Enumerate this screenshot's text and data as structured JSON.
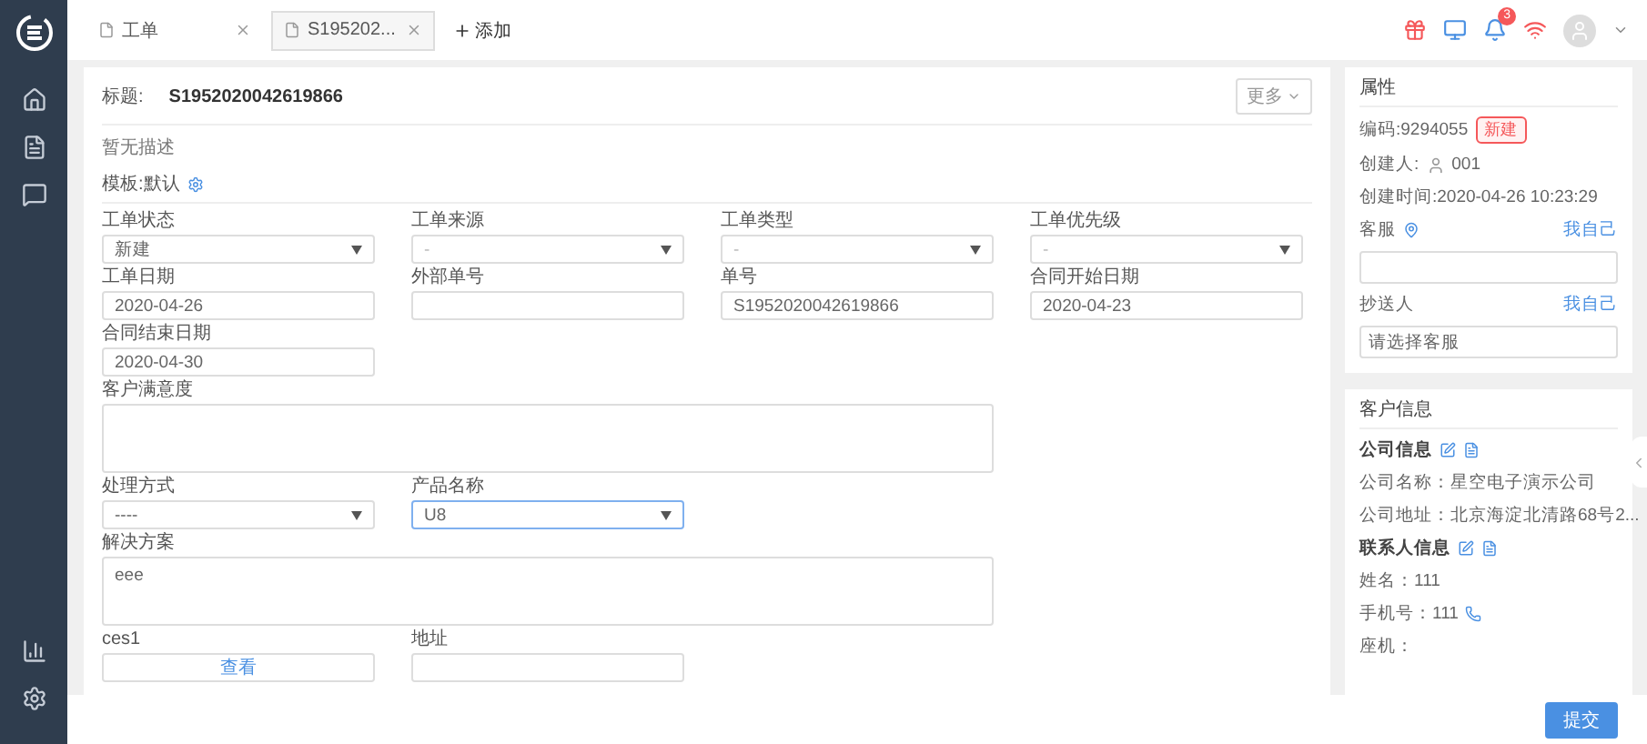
{
  "tabs": [
    {
      "label": "工单",
      "selected": false
    },
    {
      "label": "S195202...",
      "selected": true
    }
  ],
  "add_tab": "添加",
  "notifications": {
    "count": "3"
  },
  "main": {
    "title_label": "标题:",
    "title": "S1952020042619866",
    "more_button": "更多",
    "description": "暂无描述",
    "template": "模板:默认",
    "rows": [
      [
        {
          "kind": "select",
          "label": "工单状态",
          "value": "新建",
          "focused": false
        },
        {
          "kind": "select",
          "label": "工单来源",
          "placeholder": "-",
          "focused": false
        },
        {
          "kind": "select",
          "label": "工单类型",
          "placeholder": "-",
          "focused": false
        },
        {
          "kind": "select",
          "label": "工单优先级",
          "placeholder": "-",
          "focused": false
        }
      ],
      [
        {
          "kind": "input",
          "label": "工单日期",
          "value": "2020-04-26"
        },
        {
          "kind": "input",
          "label": "外部单号"
        },
        {
          "kind": "input",
          "label": "单号",
          "value": "S1952020042619866"
        },
        {
          "kind": "input",
          "label": "合同开始日期",
          "value": "2020-04-23"
        }
      ],
      [
        {
          "kind": "input",
          "label": "合同结束日期",
          "value": "2020-04-30"
        }
      ],
      [
        {
          "kind": "textarea",
          "label": "客户满意度"
        }
      ],
      [
        {
          "kind": "select",
          "label": "处理方式",
          "value": "----",
          "focused": false
        },
        {
          "kind": "select",
          "label": "产品名称",
          "value": "U8",
          "focused": true
        }
      ],
      [
        {
          "kind": "textarea",
          "label": "解决方案",
          "value": "eee"
        }
      ],
      [
        {
          "kind": "link",
          "label": "ces1",
          "value": "查看"
        },
        {
          "kind": "input",
          "label": "地址"
        }
      ]
    ]
  },
  "attributes": {
    "title": "属性",
    "code": "编码:9294055",
    "status": {
      "label": "新建",
      "color": "#f5585a"
    },
    "creator_label": "创建人:",
    "creator": "001",
    "created_time": "创建时间:2020-04-26 10:23:29",
    "service": {
      "label": "客服",
      "link": "我自己"
    },
    "cc": {
      "label": "抄送人",
      "link": "我自己",
      "placeholder": "请选择客服"
    }
  },
  "customer": {
    "title": "客户信息",
    "sections": [
      {
        "title": "公司信息",
        "lines": [
          {
            "text": "公司名称：星空电子演示公司",
            "phone": false
          },
          {
            "text": "公司地址：北京海淀北清路68号2...",
            "phone": false
          }
        ]
      },
      {
        "title": "联系人信息",
        "lines": [
          {
            "text": "姓名：111",
            "phone": false
          },
          {
            "text": "手机号：111",
            "phone": true
          },
          {
            "text": "座机：",
            "phone": false
          }
        ]
      }
    ]
  },
  "submit": "提交"
}
